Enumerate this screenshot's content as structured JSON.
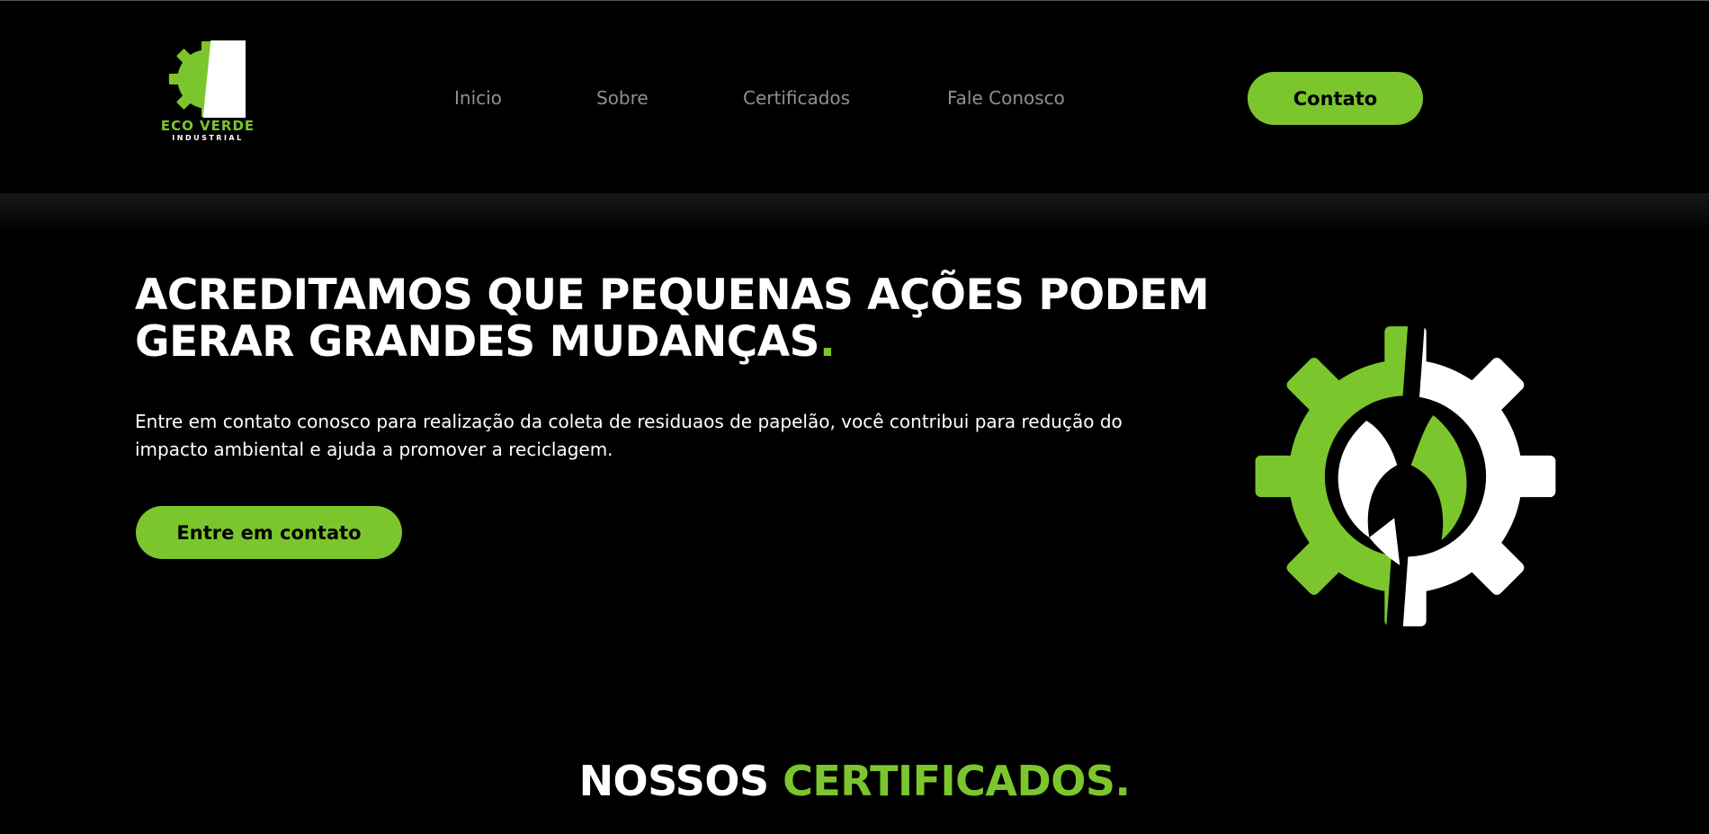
{
  "brand": {
    "name": "ECO VERDE",
    "tagline": "INDUSTRIAL",
    "accent_color": "#7bc62d",
    "logo_icon": "gear-leaf-logo"
  },
  "nav": {
    "items": [
      "Inicio",
      "Sobre",
      "Certificados",
      "Fale Conosco"
    ]
  },
  "header": {
    "contact_button": "Contato"
  },
  "hero": {
    "title": "ACREDITAMOS QUE PEQUENAS AÇÕES PODEM GERAR GRANDES MUDANÇAS",
    "title_end": ".",
    "description": "Entre em contato conosco para realização da coleta de residuaos de papelão, você contribui para redução do impacto ambiental e ajuda a promover a reciclagem.",
    "cta_button": "Entre em contato",
    "emblem_icon": "gear-leaf-emblem"
  },
  "certificates": {
    "title_white": "NOSSOS",
    "title_green": "CERTIFICADOS."
  }
}
